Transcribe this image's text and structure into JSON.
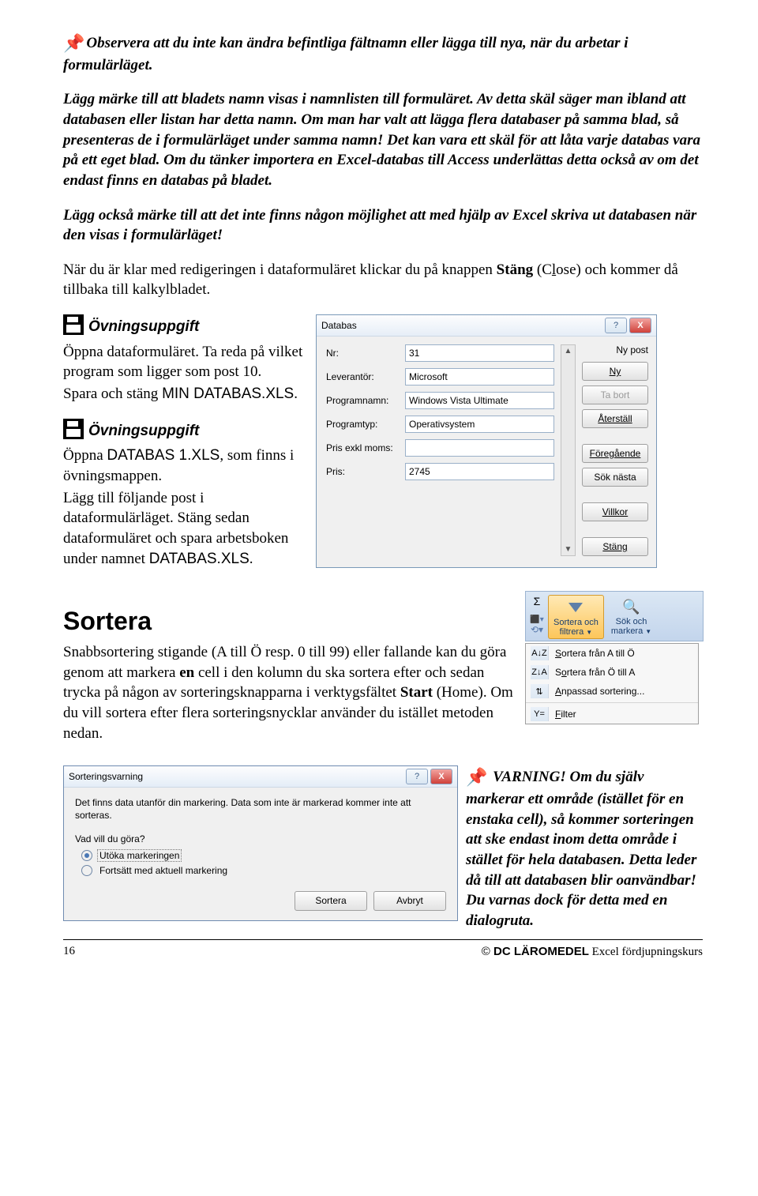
{
  "para1": "Observera att du inte kan ändra befintliga fältnamn eller lägga till nya, när du arbetar i formulärläget.",
  "para2": "Lägg märke till att bladets namn visas i namnlisten till formuläret. Av detta skäl säger man ibland att databasen eller listan har detta namn. Om man har valt att lägga flera databaser på samma blad, så presenteras de i formulärläget under samma namn! Det kan vara ett skäl för att låta varje databas vara på ett eget blad. Om du tänker importera en Excel-databas till Access underlättas detta också av om det endast finns en databas på bladet.",
  "para3": "Lägg också märke till att det inte finns någon möjlighet att med hjälp av Excel skriva ut databasen när den visas i formulärläget!",
  "para4_a": "När du är klar med redigeringen i dataformuläret klickar du på knappen ",
  "para4_b": "Stäng",
  "para4_c": " (C",
  "para4_d": "l",
  "para4_e": "ose) och kommer då tillbaka till kalkylbladet.",
  "exercise_label": "Övningsuppgift",
  "ex1_a": "Öppna dataformuläret. Ta reda på vilket program som ligger som post 10.",
  "ex1_b": "Spara och stäng ",
  "ex1_file": "MIN DATABAS.XLS",
  "ex1_dot": ".",
  "ex2_a": "Öppna ",
  "ex2_file1": "DATABAS 1.XLS",
  "ex2_b": ", som finns i övningsmappen.",
  "ex2_c": "Lägg till följande post i dataformulärläget. Stäng sedan dataformuläret och spara arbetsboken under namnet ",
  "ex2_file2": "DATABAS.XLS",
  "ex2_dot": ".",
  "sortera_heading": "Sortera",
  "sort_para_a": "Snabbsortering stigande (A till Ö resp. 0 till 99) eller fallande kan du göra genom att markera ",
  "sort_para_b": "en",
  "sort_para_c": " cell i den kolumn du ska sortera efter och sedan trycka på någon av sorteringsknapparna i verktygsfältet ",
  "sort_para_d": "Start",
  "sort_para_e": " (Home). Om du vill sortera efter flera sorteringsnycklar använder du istället metoden nedan.",
  "warning_label": "VARNING!",
  "warning_text": " Om du själv markerar ett område (istället för en enstaka cell), så kommer sorteringen att ske endast inom detta område i stället för hela databasen. Detta leder då till att databasen blir oanvändbar! Du varnas dock för detta med en dialogruta.",
  "footer_page": "16",
  "footer_copy": "©",
  "footer_brand": "DC  LÄROMEDEL",
  "footer_tail": "  Excel fördjupningskurs",
  "dlg": {
    "title": "Databas",
    "help": "?",
    "close": "X",
    "labels": {
      "nr": "Nr:",
      "lev": "Leverantör:",
      "prog": "Programnamn:",
      "typ": "Programtyp:",
      "prisex": "Pris exkl moms:",
      "pris": "Pris:"
    },
    "values": {
      "nr": "31",
      "lev": "Microsoft",
      "prog": "Windows Vista Ultimate",
      "typ": "Operativsystem",
      "prisex": "",
      "pris": "2745"
    },
    "side": {
      "status": "Ny post",
      "ny": "Ny",
      "tabort": "Ta bort",
      "aterstall": "Återställ",
      "foregaende": "Föregående",
      "soknasta": "Sök nästa",
      "villkor": "Villkor",
      "stang": "Stäng"
    }
  },
  "ribbon": {
    "sigma": "Σ",
    "sort": "Sortera och",
    "sort2": "filtrera",
    "find": "Sök och",
    "find2": "markera"
  },
  "dropdown": {
    "az_icon": "A↓Z",
    "za_icon": "Z↓A",
    "item1": "Sortera från A till Ö",
    "item1_u": "S",
    "item2": "Sortera från Ö till A",
    "item2_u": "o",
    "custom_icon": "⇅",
    "item3_u": "A",
    "item3": "npassad sortering...",
    "filter_icon": "Y=",
    "item4_u": "F",
    "item4": "ilter"
  },
  "warn_dlg": {
    "title": "Sorteringsvarning",
    "msg": "Det finns data utanför din markering. Data som inte är markerad kommer inte att sorteras.",
    "q": "Vad vill du göra?",
    "opt1": "Utöka markeringen",
    "opt1_u": "U",
    "opt2": "Fortsätt med aktuell markering",
    "opt2_u": "F",
    "sortera_u": "S",
    "sortera": "ortera",
    "avbryt": "Avbryt"
  }
}
